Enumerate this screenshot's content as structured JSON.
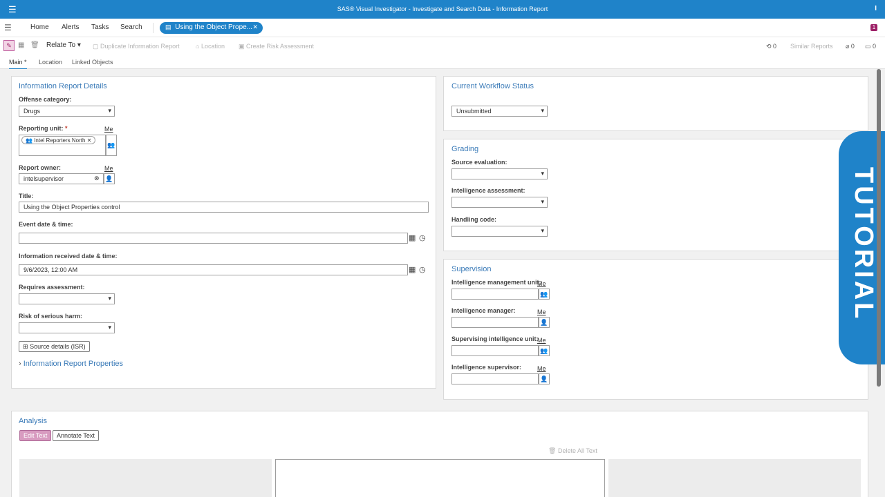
{
  "topbar": {
    "title": "SAS® Visual Investigator - Investigate and Search Data - Information Report",
    "user_initial": "I"
  },
  "nav": {
    "links": [
      "Home",
      "Alerts",
      "Tasks",
      "Search"
    ],
    "active_tab": "Using the Object Prope...",
    "badge": "1"
  },
  "toolbar": {
    "relate_to": "Relate To",
    "duplicate": "Duplicate Information Report",
    "location": "Location",
    "create_risk": "Create Risk Assessment",
    "tasks_count": "0",
    "similar_reports": "Similar Reports",
    "attachments_count": "0",
    "comments_count": "0"
  },
  "tabs": [
    "Main *",
    "Location",
    "Linked Objects"
  ],
  "details": {
    "title": "Information Report Details",
    "offense_label": "Offense category:",
    "offense_value": "Drugs",
    "reporting_unit_label": "Reporting unit:",
    "reporting_unit_req": "*",
    "me": "Me",
    "reporting_unit_chip": "Intel Reporters North",
    "report_owner_label": "Report owner:",
    "report_owner_value": "intelsupervisor",
    "title_label": "Title:",
    "title_value": "Using the Object Properties control",
    "event_label": "Event date & time:",
    "received_label": "Information received date & time:",
    "received_value": "9/6/2023, 12:00 AM",
    "requires_label": "Requires assessment:",
    "risk_label": "Risk of serious harm:",
    "source_button": "Source details (ISR)",
    "properties_link": "Information Report Properties"
  },
  "workflow": {
    "title": "Current Workflow Status",
    "value": "Unsubmitted"
  },
  "grading": {
    "title": "Grading",
    "source_label": "Source evaluation:",
    "intel_label": "Intelligence assessment:",
    "handling_label": "Handling code:"
  },
  "supervision": {
    "title": "Supervision",
    "mgmt_unit_label": "Intelligence management unit:",
    "manager_label": "Intelligence manager:",
    "sup_unit_label": "Supervising intelligence unit:",
    "supervisor_label": "Intelligence supervisor:",
    "me": "Me"
  },
  "analysis": {
    "title": "Analysis",
    "edit_text": "Edit Text",
    "annotate_text": "Annotate Text",
    "delete_all": "Delete All Text"
  },
  "tutorial": "TUTORIAL",
  "colors": {
    "brand_blue": "#1f83c9",
    "accent_magenta": "#9d2067"
  }
}
